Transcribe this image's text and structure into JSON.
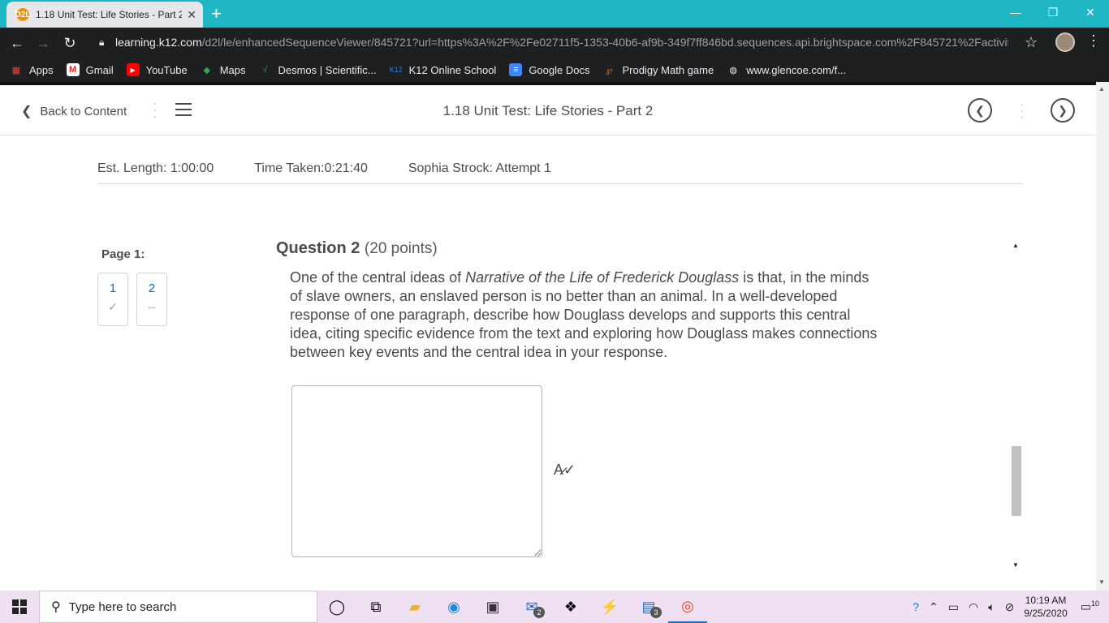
{
  "browser": {
    "tab_title": "1.18 Unit Test: Life Stories - Part 2",
    "tab_favicon": "D2L",
    "url_domain": "learning.k12.com",
    "url_path": "/d2l/le/enhancedSequenceViewer/845721?url=https%3A%2F%2Fe02711f5-1353-40b6-af9b-349f7ff846bd.sequences.api.brightspace.com%2F845721%2Factivity...",
    "bookmarks": [
      {
        "label": "Apps",
        "icon": "apps-grid-icon",
        "color": "#ea4335"
      },
      {
        "label": "Gmail",
        "icon": "gmail-icon",
        "color": "#d93025"
      },
      {
        "label": "YouTube",
        "icon": "youtube-icon",
        "color": "#ff0000"
      },
      {
        "label": "Maps",
        "icon": "maps-icon",
        "color": "#34a853"
      },
      {
        "label": "Desmos | Scientific...",
        "icon": "desmos-icon",
        "color": "#2f9a41"
      },
      {
        "label": "K12 Online School",
        "icon": "k12-icon",
        "color": "#2f7fd1"
      },
      {
        "label": "Google Docs",
        "icon": "google-docs-icon",
        "color": "#4285f4"
      },
      {
        "label": "Prodigy Math game",
        "icon": "prodigy-icon",
        "color": "#e8710a"
      },
      {
        "label": "www.glencoe.com/f...",
        "icon": "globe-icon",
        "color": "#e8eaed"
      }
    ]
  },
  "header": {
    "back_label": "Back to Content",
    "title": "1.18 Unit Test: Life Stories - Part 2"
  },
  "meta": {
    "est_length": "Est. Length: 1:00:00",
    "time_taken": "Time Taken:0:21:40",
    "attempt": "Sophia Strock: Attempt 1"
  },
  "pages": {
    "label": "Page 1:",
    "items": [
      {
        "number": "1",
        "status": "✓"
      },
      {
        "number": "2",
        "status": "--"
      }
    ]
  },
  "question": {
    "title": "Question 2",
    "points": "(20 points)",
    "text_before": "One of the central ideas of ",
    "text_italic": "Narrative of the Life of Frederick Douglass",
    "text_after": " is that, in the minds of slave owners, an enslaved person is no better than an animal. In a well-developed response of one paragraph, describe how Douglass develops and supports this central idea, citing specific evidence from the text and exploring how Douglass makes connections between key events and the central idea in your response.",
    "answer_value": ""
  },
  "taskbar": {
    "search_placeholder": "Type here to search",
    "mail_badge": "2",
    "explorer_badge": "3",
    "notif_badge": "10",
    "time": "10:19 AM",
    "date": "9/25/2020"
  }
}
